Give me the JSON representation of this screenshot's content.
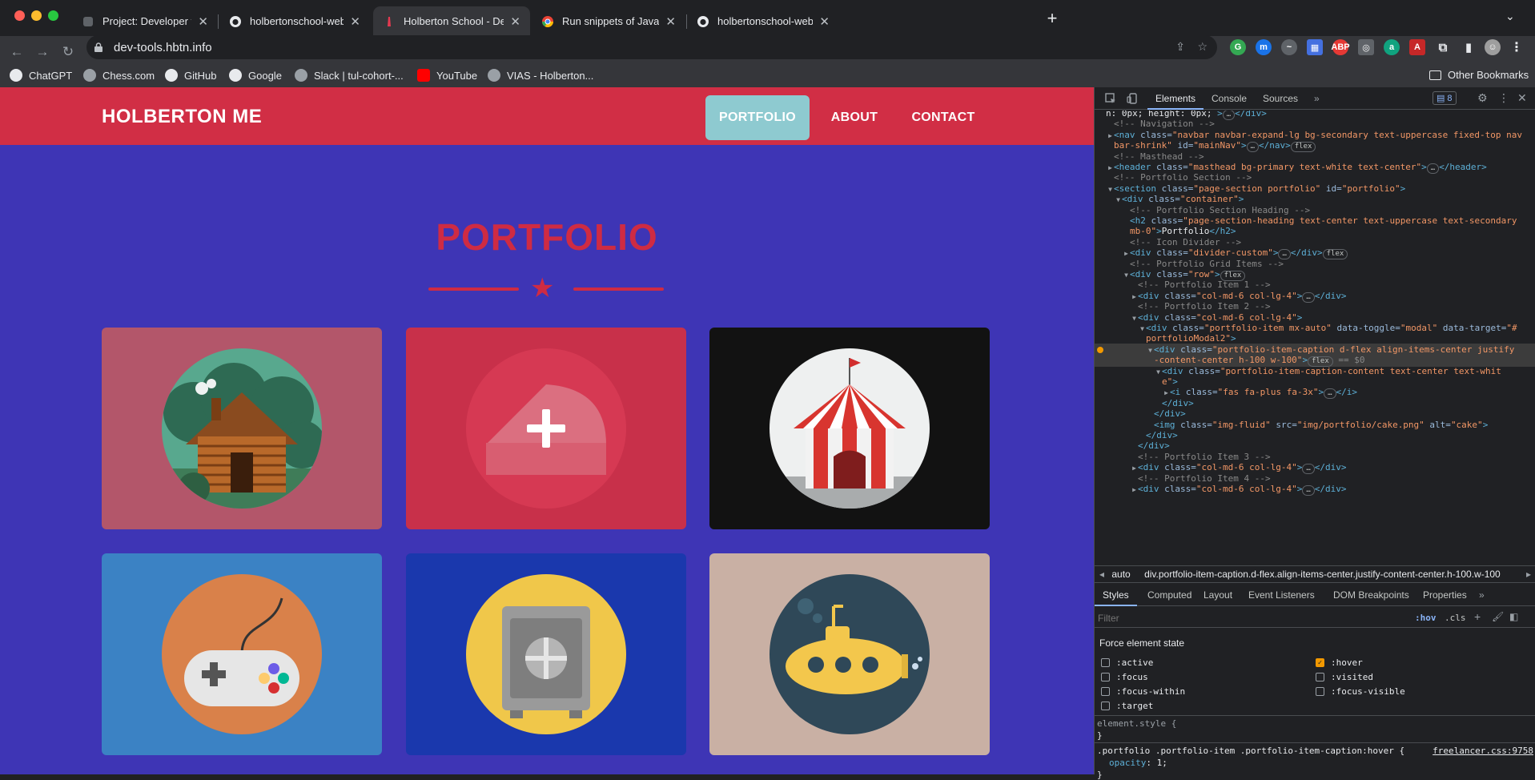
{
  "browser": {
    "tabs": [
      {
        "title": "Project: Developer tools | Holbe",
        "icon": "holberton-icon"
      },
      {
        "title": "holbertonschool-web_front_en",
        "icon": "github-icon"
      },
      {
        "title": "Holberton School - Developer t",
        "icon": "holberton-icon"
      },
      {
        "title": "Run snippets of JavaScript - Ch",
        "icon": "chrome-icon"
      },
      {
        "title": "holbertonschool-web_front_en",
        "icon": "github-icon"
      }
    ],
    "active_tab": 2,
    "url": "dev-tools.hbtn.info",
    "bookmarks": [
      "ChatGPT",
      "Chess.com",
      "GitHub",
      "Google",
      "Slack | tul-cohort-...",
      "YouTube",
      "VIAS - Holberton..."
    ],
    "other_bookmarks": "Other Bookmarks"
  },
  "site": {
    "brand": "HOLBERTON ME",
    "nav": [
      "PORTFOLIO",
      "ABOUT",
      "CONTACT"
    ],
    "heading": "PORTFOLIO",
    "colors": {
      "nav_bg": "#d12e45",
      "page_bg": "#3e35b5",
      "accent": "#cf2b43",
      "active_nav": "#8ecad0"
    },
    "portfolio_items": [
      {
        "name": "cabin",
        "bg": "#b3566a",
        "hover_caption": false
      },
      {
        "name": "cake",
        "bg": "#c8304a",
        "hover_caption": true,
        "caption_icon": "plus-icon"
      },
      {
        "name": "circus",
        "bg": "#121212",
        "hover_caption": false
      },
      {
        "name": "game",
        "bg": "#3b82c4",
        "hover_caption": false
      },
      {
        "name": "safe",
        "bg": "#1a38ad",
        "hover_caption": false
      },
      {
        "name": "submarine",
        "bg": "#c9b0a4",
        "hover_caption": false
      }
    ]
  },
  "devtools": {
    "tabs": [
      "Elements",
      "Console",
      "Sources"
    ],
    "issues_count": "8",
    "tree": [
      {
        "i": 0,
        "parts": [
          [
            "tx",
            "n: 0px; height: 0px; "
          ],
          [
            "tag",
            ">"
          ],
          [
            "badge",
            "…"
          ],
          [
            "tag",
            "</div>"
          ]
        ]
      },
      {
        "i": 1,
        "parts": [
          [
            "cm",
            "<!-- Navigation -->"
          ]
        ]
      },
      {
        "i": 1,
        "arrow": "▶",
        "parts": [
          [
            "tag",
            "<nav "
          ],
          [
            "an",
            "class="
          ],
          [
            "av",
            "\"navbar navbar-expand-lg bg-secondary text-uppercase fixed-top nav"
          ]
        ]
      },
      {
        "i": 1,
        "parts": [
          [
            "av",
            "bar-shrink\""
          ],
          [
            "an",
            " id="
          ],
          [
            "av",
            "\"mainNav\""
          ],
          [
            "tag",
            ">"
          ],
          [
            "badge",
            "…"
          ],
          [
            "tag",
            "</nav>"
          ],
          [
            "badge",
            "flex"
          ]
        ]
      },
      {
        "i": 1,
        "parts": [
          [
            "cm",
            "<!-- Masthead -->"
          ]
        ]
      },
      {
        "i": 1,
        "arrow": "▶",
        "parts": [
          [
            "tag",
            "<header "
          ],
          [
            "an",
            "class="
          ],
          [
            "av",
            "\"masthead bg-primary text-white text-center\""
          ],
          [
            "tag",
            ">"
          ],
          [
            "badge",
            "…"
          ],
          [
            "tag",
            "</header>"
          ]
        ]
      },
      {
        "i": 1,
        "parts": [
          [
            "cm",
            "<!-- Portfolio Section -->"
          ]
        ]
      },
      {
        "i": 1,
        "arrow": "▼",
        "parts": [
          [
            "tag",
            "<section "
          ],
          [
            "an",
            "class="
          ],
          [
            "av",
            "\"page-section portfolio\""
          ],
          [
            "an",
            " id="
          ],
          [
            "av",
            "\"portfolio\""
          ],
          [
            "tag",
            ">"
          ]
        ]
      },
      {
        "i": 2,
        "arrow": "▼",
        "parts": [
          [
            "tag",
            "<div "
          ],
          [
            "an",
            "class="
          ],
          [
            "av",
            "\"container\""
          ],
          [
            "tag",
            ">"
          ]
        ]
      },
      {
        "i": 3,
        "parts": [
          [
            "cm",
            "<!-- Portfolio Section Heading -->"
          ]
        ]
      },
      {
        "i": 3,
        "parts": [
          [
            "tag",
            "<h2 "
          ],
          [
            "an",
            "class="
          ],
          [
            "av",
            "\"page-section-heading text-center text-uppercase text-secondary"
          ]
        ]
      },
      {
        "i": 3,
        "parts": [
          [
            "av",
            "mb-0\""
          ],
          [
            "tag",
            ">"
          ],
          [
            "tx",
            "Portfolio"
          ],
          [
            "tag",
            "</h2>"
          ]
        ]
      },
      {
        "i": 3,
        "parts": [
          [
            "cm",
            "<!-- Icon Divider -->"
          ]
        ]
      },
      {
        "i": 3,
        "arrow": "▶",
        "parts": [
          [
            "tag",
            "<div "
          ],
          [
            "an",
            "class="
          ],
          [
            "av",
            "\"divider-custom\""
          ],
          [
            "tag",
            ">"
          ],
          [
            "badge",
            "…"
          ],
          [
            "tag",
            "</div>"
          ],
          [
            "badge",
            "flex"
          ]
        ]
      },
      {
        "i": 3,
        "parts": [
          [
            "cm",
            "<!-- Portfolio Grid Items -->"
          ]
        ]
      },
      {
        "i": 3,
        "arrow": "▼",
        "parts": [
          [
            "tag",
            "<div "
          ],
          [
            "an",
            "class="
          ],
          [
            "av",
            "\"row\""
          ],
          [
            "tag",
            ">"
          ],
          [
            "badge",
            "flex"
          ]
        ]
      },
      {
        "i": 4,
        "parts": [
          [
            "cm",
            "<!-- Portfolio Item 1 -->"
          ]
        ]
      },
      {
        "i": 4,
        "arrow": "▶",
        "parts": [
          [
            "tag",
            "<div "
          ],
          [
            "an",
            "class="
          ],
          [
            "av",
            "\"col-md-6 col-lg-4\""
          ],
          [
            "tag",
            ">"
          ],
          [
            "badge",
            "…"
          ],
          [
            "tag",
            "</div>"
          ]
        ]
      },
      {
        "i": 4,
        "parts": [
          [
            "cm",
            "<!-- Portfolio Item 2 -->"
          ]
        ]
      },
      {
        "i": 4,
        "arrow": "▼",
        "parts": [
          [
            "tag",
            "<div "
          ],
          [
            "an",
            "class="
          ],
          [
            "av",
            "\"col-md-6 col-lg-4\""
          ],
          [
            "tag",
            ">"
          ]
        ]
      },
      {
        "i": 5,
        "arrow": "▼",
        "parts": [
          [
            "tag",
            "<div "
          ],
          [
            "an",
            "class="
          ],
          [
            "av",
            "\"portfolio-item mx-auto\""
          ],
          [
            "an",
            " data-toggle="
          ],
          [
            "av",
            "\"modal\""
          ],
          [
            "an",
            " data-target="
          ],
          [
            "av",
            "\"#"
          ]
        ]
      },
      {
        "i": 5,
        "parts": [
          [
            "av",
            "portfolioModal2\""
          ],
          [
            "tag",
            ">"
          ]
        ]
      },
      {
        "i": 6,
        "hl": true,
        "arrow": "▼",
        "parts": [
          [
            "tag",
            "<div "
          ],
          [
            "an",
            "class="
          ],
          [
            "av",
            "\"portfolio-item-caption d-flex align-items-center justify"
          ]
        ]
      },
      {
        "i": 6,
        "hl": true,
        "parts": [
          [
            "av",
            "-content-center h-100 w-100\""
          ],
          [
            "tag",
            ">"
          ],
          [
            "badge",
            "flex"
          ],
          [
            "cm",
            " == $0"
          ]
        ]
      },
      {
        "i": 7,
        "arrow": "▼",
        "parts": [
          [
            "tag",
            "<div "
          ],
          [
            "an",
            "class="
          ],
          [
            "av",
            "\"portfolio-item-caption-content text-center text-whit"
          ]
        ]
      },
      {
        "i": 7,
        "parts": [
          [
            "av",
            "e\""
          ],
          [
            "tag",
            ">"
          ]
        ]
      },
      {
        "i": 8,
        "arrow": "▶",
        "parts": [
          [
            "tag",
            "<i "
          ],
          [
            "an",
            "class="
          ],
          [
            "av",
            "\"fas fa-plus fa-3x\""
          ],
          [
            "tag",
            ">"
          ],
          [
            "badge",
            "…"
          ],
          [
            "tag",
            "</i>"
          ]
        ]
      },
      {
        "i": 7,
        "parts": [
          [
            "tag",
            "</div>"
          ]
        ]
      },
      {
        "i": 6,
        "parts": [
          [
            "tag",
            "</div>"
          ]
        ]
      },
      {
        "i": 6,
        "parts": [
          [
            "tag",
            "<img "
          ],
          [
            "an",
            "class="
          ],
          [
            "av",
            "\"img-fluid\""
          ],
          [
            "an",
            " src="
          ],
          [
            "av",
            "\"img/portfolio/cake.png\""
          ],
          [
            "an",
            " alt="
          ],
          [
            "av",
            "\"cake\""
          ],
          [
            "tag",
            ">"
          ]
        ]
      },
      {
        "i": 5,
        "parts": [
          [
            "tag",
            "</div>"
          ]
        ]
      },
      {
        "i": 4,
        "parts": [
          [
            "tag",
            "</div>"
          ]
        ]
      },
      {
        "i": 4,
        "parts": [
          [
            "cm",
            "<!-- Portfolio Item 3 -->"
          ]
        ]
      },
      {
        "i": 4,
        "arrow": "▶",
        "parts": [
          [
            "tag",
            "<div "
          ],
          [
            "an",
            "class="
          ],
          [
            "av",
            "\"col-md-6 col-lg-4\""
          ],
          [
            "tag",
            ">"
          ],
          [
            "badge",
            "…"
          ],
          [
            "tag",
            "</div>"
          ]
        ]
      },
      {
        "i": 4,
        "parts": [
          [
            "cm",
            "<!-- Portfolio Item 4 -->"
          ]
        ]
      },
      {
        "i": 4,
        "arrow": "▶",
        "parts": [
          [
            "tag",
            "<div "
          ],
          [
            "an",
            "class="
          ],
          [
            "av",
            "\"col-md-6 col-lg-4\""
          ],
          [
            "tag",
            ">"
          ],
          [
            "badge",
            "…"
          ],
          [
            "tag",
            "</div>"
          ]
        ]
      }
    ],
    "breadcrumb": [
      "auto",
      "div.portfolio-item-caption.d-flex.align-items-center.justify-content-center.h-100.w-100"
    ],
    "style_tabs": [
      "Styles",
      "Computed",
      "Layout",
      "Event Listeners",
      "DOM Breakpoints",
      "Properties"
    ],
    "filter_placeholder": "Filter",
    "hov": ":hov",
    "cls": ".cls",
    "force_state_title": "Force element state",
    "states": [
      {
        "label": ":active",
        "checked": false
      },
      {
        "label": ":hover",
        "checked": true
      },
      {
        "label": ":focus",
        "checked": false
      },
      {
        "label": ":visited",
        "checked": false
      },
      {
        "label": ":focus-within",
        "checked": false
      },
      {
        "label": ":focus-visible",
        "checked": false
      },
      {
        "label": ":target",
        "checked": false
      }
    ],
    "element_style": "element.style {",
    "close_brace": "}",
    "rule_selector": ".portfolio .portfolio-item .portfolio-item-caption:hover {",
    "rule_source": "freelancer.css:9758",
    "rule_prop": "opacity",
    "rule_val": "1;"
  }
}
